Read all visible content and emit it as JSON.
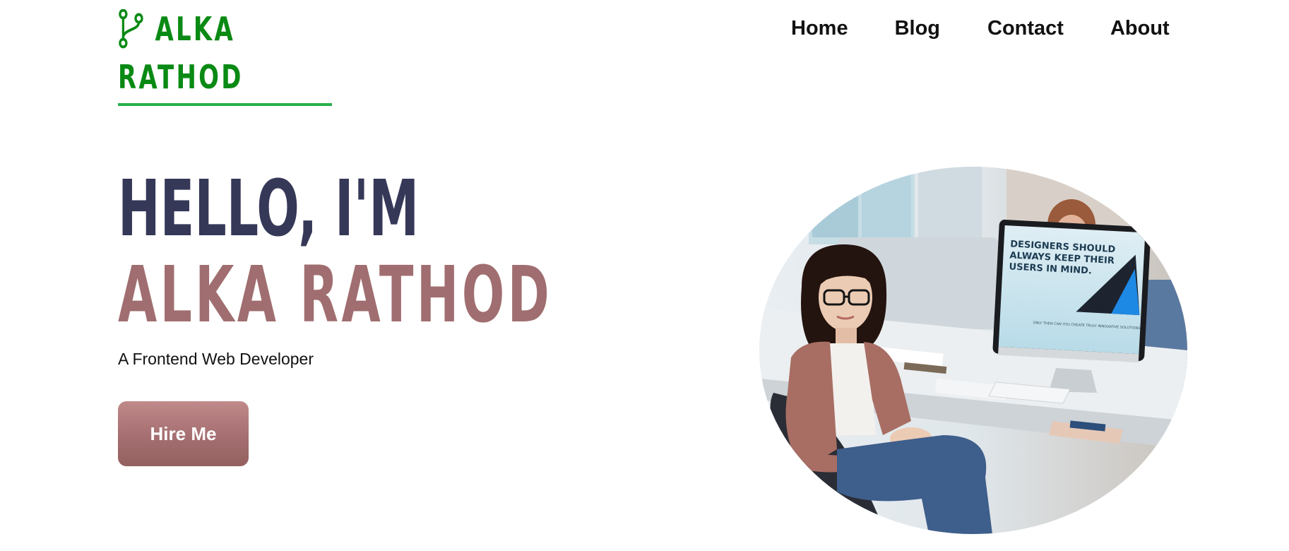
{
  "logo": {
    "line1": "ALKA",
    "line2": "RATHOD",
    "icon": "git-branch-icon",
    "color": "#0a8a14",
    "underline_color": "#28b04a"
  },
  "nav": {
    "items": [
      "Home",
      "Blog",
      "Contact",
      "About"
    ]
  },
  "hero": {
    "greeting": "HELLO, I'M",
    "name": "ALKA RATHOD",
    "subtitle": "A Frontend Web Developer",
    "cta_label": "Hire Me",
    "greeting_color": "#363858",
    "name_color": "#a06e70",
    "cta_color": "#a56f71"
  },
  "image": {
    "screen_text_line1": "DESIGNERS SHOULD",
    "screen_text_line2": "ALWAYS KEEP THEIR",
    "screen_text_line3": "USERS IN MIND.",
    "screen_footer": "ONLY THEN CAN YOU CREATE TRULY INNOVATIVE SOLUTIONS"
  }
}
